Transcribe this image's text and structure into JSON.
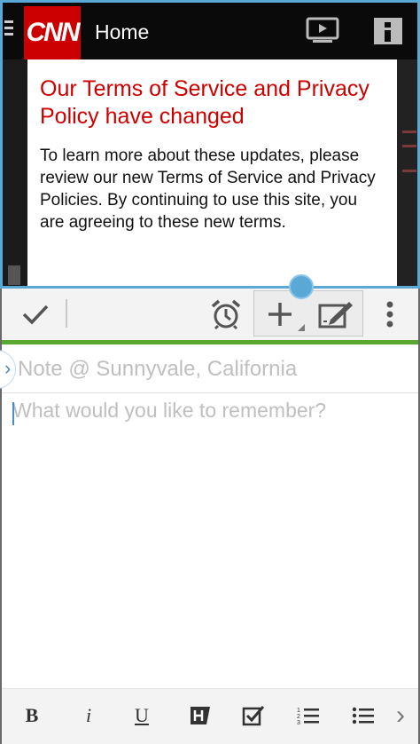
{
  "cnn": {
    "logo_text": "CNN",
    "home_label": "Home",
    "terms": {
      "title": "Our Terms of Service and Privacy Policy have changed",
      "body": "To learn more about these updates, please review our new Terms of Service and Privacy Policies. By continuing to use this site, you are agreeing to these new terms."
    }
  },
  "note": {
    "title_placeholder": "Note @ Sunnyvale, California",
    "body_placeholder": "What would you like to remember?"
  },
  "format": {
    "bold": "B",
    "italic": "i",
    "underline": "U"
  },
  "colors": {
    "cnn_red": "#cc0000",
    "split_blue": "#5aa8d6",
    "accent_green": "#5aa832"
  }
}
